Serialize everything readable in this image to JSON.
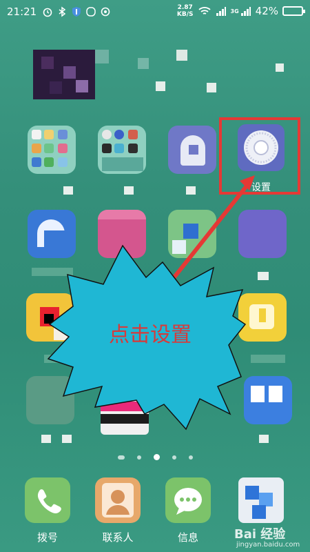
{
  "status_bar": {
    "time": "21:21",
    "speed_value": "2.87",
    "speed_unit": "KB/S",
    "signal_tag": "3G",
    "battery": "42%"
  },
  "highlight": {
    "settings_label": "设置",
    "callout_text": "点击设置",
    "callout_color": "#d83a3a",
    "frame_color": "#e53935"
  },
  "page_indicator": {
    "count": 5,
    "active_index": 2
  },
  "dock": [
    {
      "label": "拨号",
      "icon": "phone-icon"
    },
    {
      "label": "联系人",
      "icon": "contacts-icon"
    },
    {
      "label": "信息",
      "icon": "message-icon"
    }
  ],
  "watermark": {
    "brand": "Bai 经验",
    "url": "jingyan.baidu.com"
  }
}
